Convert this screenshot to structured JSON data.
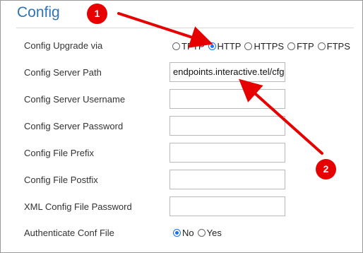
{
  "section": {
    "title": "Config"
  },
  "rows": [
    {
      "label": "Config Upgrade via"
    },
    {
      "label": "Config Server Path",
      "value": "endpoints.interactive.tel/cfg"
    },
    {
      "label": "Config Server Username",
      "value": ""
    },
    {
      "label": "Config Server Password",
      "value": ""
    },
    {
      "label": "Config File Prefix",
      "value": ""
    },
    {
      "label": "Config File Postfix",
      "value": ""
    },
    {
      "label": "XML Config File Password",
      "value": ""
    },
    {
      "label": "Authenticate Conf File"
    }
  ],
  "upgrade_protocols": {
    "options": [
      "TFTP",
      "HTTP",
      "HTTPS",
      "FTP",
      "FTPS"
    ],
    "selected": "HTTP"
  },
  "authenticate": {
    "options": [
      "No",
      "Yes"
    ],
    "selected": "No"
  },
  "annotations": {
    "badge_1": "1",
    "badge_2": "2",
    "color": "#e60000"
  },
  "colors": {
    "title": "#2f75b5",
    "radio_selected": "#1a73e8"
  }
}
